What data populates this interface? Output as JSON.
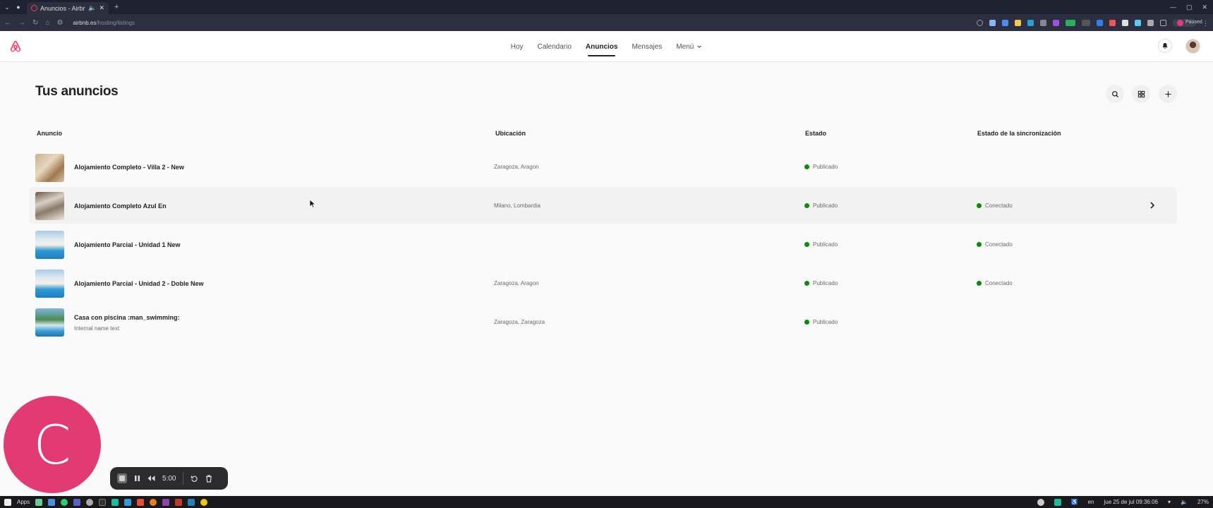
{
  "browser": {
    "tab_title": "Anuncios - Airbnb",
    "url_host": "airbnb.es",
    "url_path": "/hosting/listings",
    "paused_label": "Paused"
  },
  "nav": {
    "items": [
      {
        "label": "Hoy"
      },
      {
        "label": "Calendario"
      },
      {
        "label": "Anuncios"
      },
      {
        "label": "Mensajes"
      },
      {
        "label": "Menú"
      }
    ]
  },
  "page": {
    "title": "Tus anuncios"
  },
  "table": {
    "headers": [
      "Anuncio",
      "Ubicación",
      "Estado",
      "Estado de la sincronización"
    ],
    "rows": [
      {
        "name": "Alojamiento Completo - Villa 2 - New",
        "subtitle": "",
        "location": "Zaragoza, Aragon",
        "status": "Publicado",
        "sync": ""
      },
      {
        "name": "Alojamiento Completo Azul En",
        "subtitle": "",
        "location": "Milano, Lombardia",
        "status": "Publicado",
        "sync": "Conectado"
      },
      {
        "name": "Alojamiento Parcial - Unidad 1 New",
        "subtitle": "",
        "location": "",
        "status": "Publicado",
        "sync": "Conectado"
      },
      {
        "name": "Alojamiento Parcial - Unidad 2 - Doble New",
        "subtitle": "",
        "location": "Zaragoza, Aragon",
        "status": "Publicado",
        "sync": "Conectado"
      },
      {
        "name": "Casa con piscina :man_swimming:",
        "subtitle": "Internal name text",
        "location": "Zaragoza, Zaragoza",
        "status": "Publicado",
        "sync": ""
      }
    ]
  },
  "recorder": {
    "avatar_letter": "C",
    "time": "5:00"
  },
  "taskbar": {
    "apps_label": "Apps",
    "lang": "en",
    "datetime": "jue 25 de jul  09:36:06",
    "battery": "27%"
  },
  "colors": {
    "brand": "#ff385c",
    "status_green": "#0b8a0b",
    "recorder_pink": "#e23b74"
  }
}
